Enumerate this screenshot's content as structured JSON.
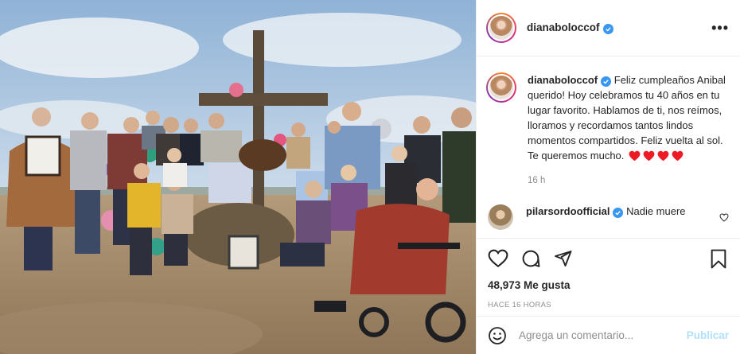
{
  "post": {
    "author": "dianabolоccof",
    "author_display": "dianaboloccof",
    "verified": true,
    "more_icon": "more-options-icon"
  },
  "caption": {
    "author": "dianaboloccof",
    "text": "Feliz cumpleaños Anibal querido! Hoy celebramos tu 40 años en tu lugar favorito. Hablamos de ti, nos reímos, lloramos y recordamos tantos lindos momentos compartidos. Feliz vuelta al sol. Te queremos mucho.",
    "emoji": [
      "heart",
      "heart",
      "heart",
      "heart"
    ],
    "time": "16 h"
  },
  "comment": {
    "author": "pilarsordoofficial",
    "verified": true,
    "text": "Nadie muere"
  },
  "actions": {
    "likes": "48,973 Me gusta",
    "posted": "HACE 16 HORAS"
  },
  "add_comment": {
    "placeholder": "Agrega un comentario...",
    "publish": "Publicar"
  },
  "colors": {
    "verified": "#3897f0",
    "heart": "#ed1c24",
    "publish_disabled": "#b2dffc",
    "secondary_text": "#8e8e8e"
  }
}
